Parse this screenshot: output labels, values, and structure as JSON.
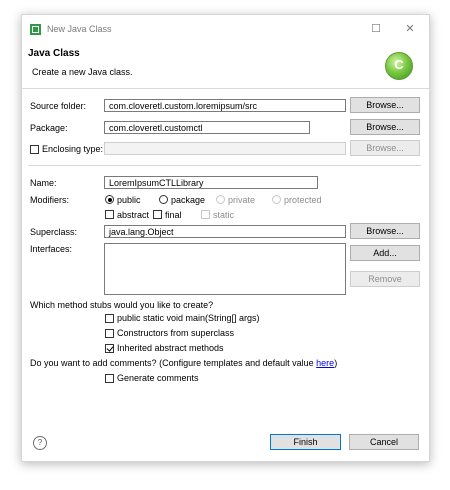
{
  "window": {
    "title": "New Java Class",
    "minimize_glyph": "☐",
    "close_glyph": "✕"
  },
  "banner": {
    "title": "Java Class",
    "description": "Create a new Java class.",
    "logo_letter": "C"
  },
  "source_folder": {
    "label": "Source folder:",
    "value": "com.cloveretl.custom.loremipsum/src",
    "browse": "Browse..."
  },
  "package": {
    "label": "Package:",
    "value": "com.cloveretl.customctl",
    "browse": "Browse..."
  },
  "enclosing_type": {
    "label": "Enclosing type:",
    "checked": false,
    "value": "",
    "browse": "Browse..."
  },
  "name": {
    "label": "Name:",
    "value": "LoremIpsumCTLLibrary"
  },
  "modifiers": {
    "label": "Modifiers:",
    "public": "public",
    "package": "package",
    "private": "private",
    "protected": "protected",
    "abstract": "abstract",
    "final": "final",
    "static": "static",
    "selected": "public"
  },
  "superclass": {
    "label": "Superclass:",
    "value": "java.lang.Object",
    "browse": "Browse..."
  },
  "interfaces": {
    "label": "Interfaces:",
    "add": "Add...",
    "remove": "Remove",
    "items": []
  },
  "method_stubs": {
    "question": "Which method stubs would you like to create?",
    "options": [
      {
        "label": "public static void main(String[] args)",
        "checked": false
      },
      {
        "label": "Constructors from superclass",
        "checked": false
      },
      {
        "label": "Inherited abstract methods",
        "checked": true
      }
    ]
  },
  "comments": {
    "question": "Do you want to add comments? (Configure templates and default value ",
    "link": "here",
    "question_end": ")",
    "generate_label": "Generate comments",
    "checked": false
  },
  "footer": {
    "help": "?",
    "finish": "Finish",
    "cancel": "Cancel"
  },
  "colors": {
    "primary_border": "#0078d7",
    "logo_green": "#7ac943",
    "link": "#0000ee"
  }
}
